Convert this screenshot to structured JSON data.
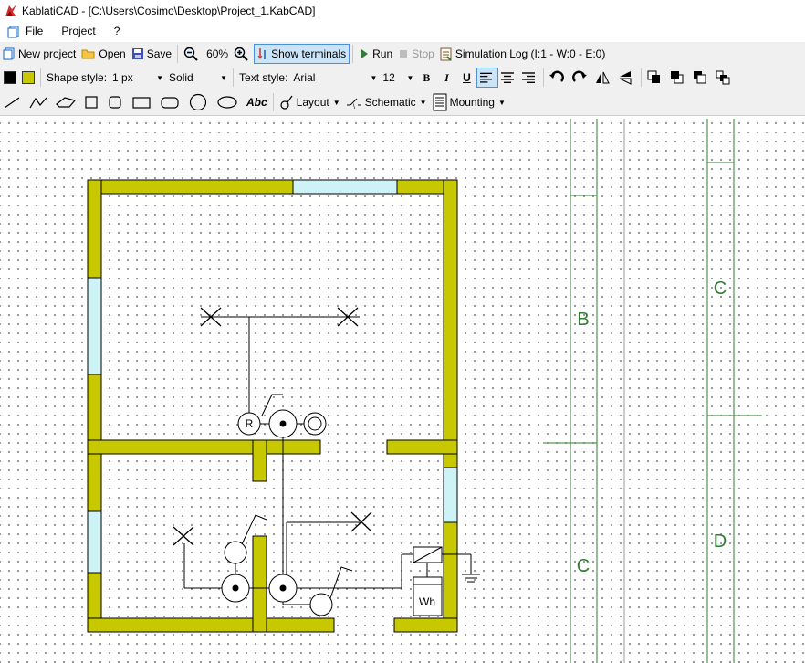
{
  "window": {
    "title": "KablatiCAD - [C:\\Users\\Cosimo\\Desktop\\Project_1.KabCAD]"
  },
  "menu": {
    "file": "File",
    "project": "Project",
    "help": "?"
  },
  "toolbar1": {
    "new_project": "New project",
    "open": "Open",
    "save": "Save",
    "zoom_level": "60%",
    "show_terminals": "Show terminals",
    "run": "Run",
    "stop": "Stop",
    "simulation_log": "Simulation Log (I:1 - W:0 - E:0)"
  },
  "toolbar2": {
    "stroke_color": "#000000",
    "fill_color": "#c8c800",
    "shape_style_label": "Shape style:",
    "line_width": "1 px",
    "line_style": "Solid",
    "text_style_label": "Text style:",
    "font": "Arial",
    "font_size": "12",
    "bold": "B",
    "italic": "I",
    "underline": "U"
  },
  "toolbar3": {
    "text_tool": "Abc",
    "layout": "Layout",
    "schematic": "Schematic",
    "mounting": "Mounting"
  },
  "drawing": {
    "wall_color": "#c8c800",
    "window_color": "#cdf3f7",
    "zone_line_color": "#2e7d32",
    "resistor_label": "R",
    "meter_label": "Wh",
    "zone_labels": [
      "B",
      "C",
      "C",
      "D"
    ]
  }
}
